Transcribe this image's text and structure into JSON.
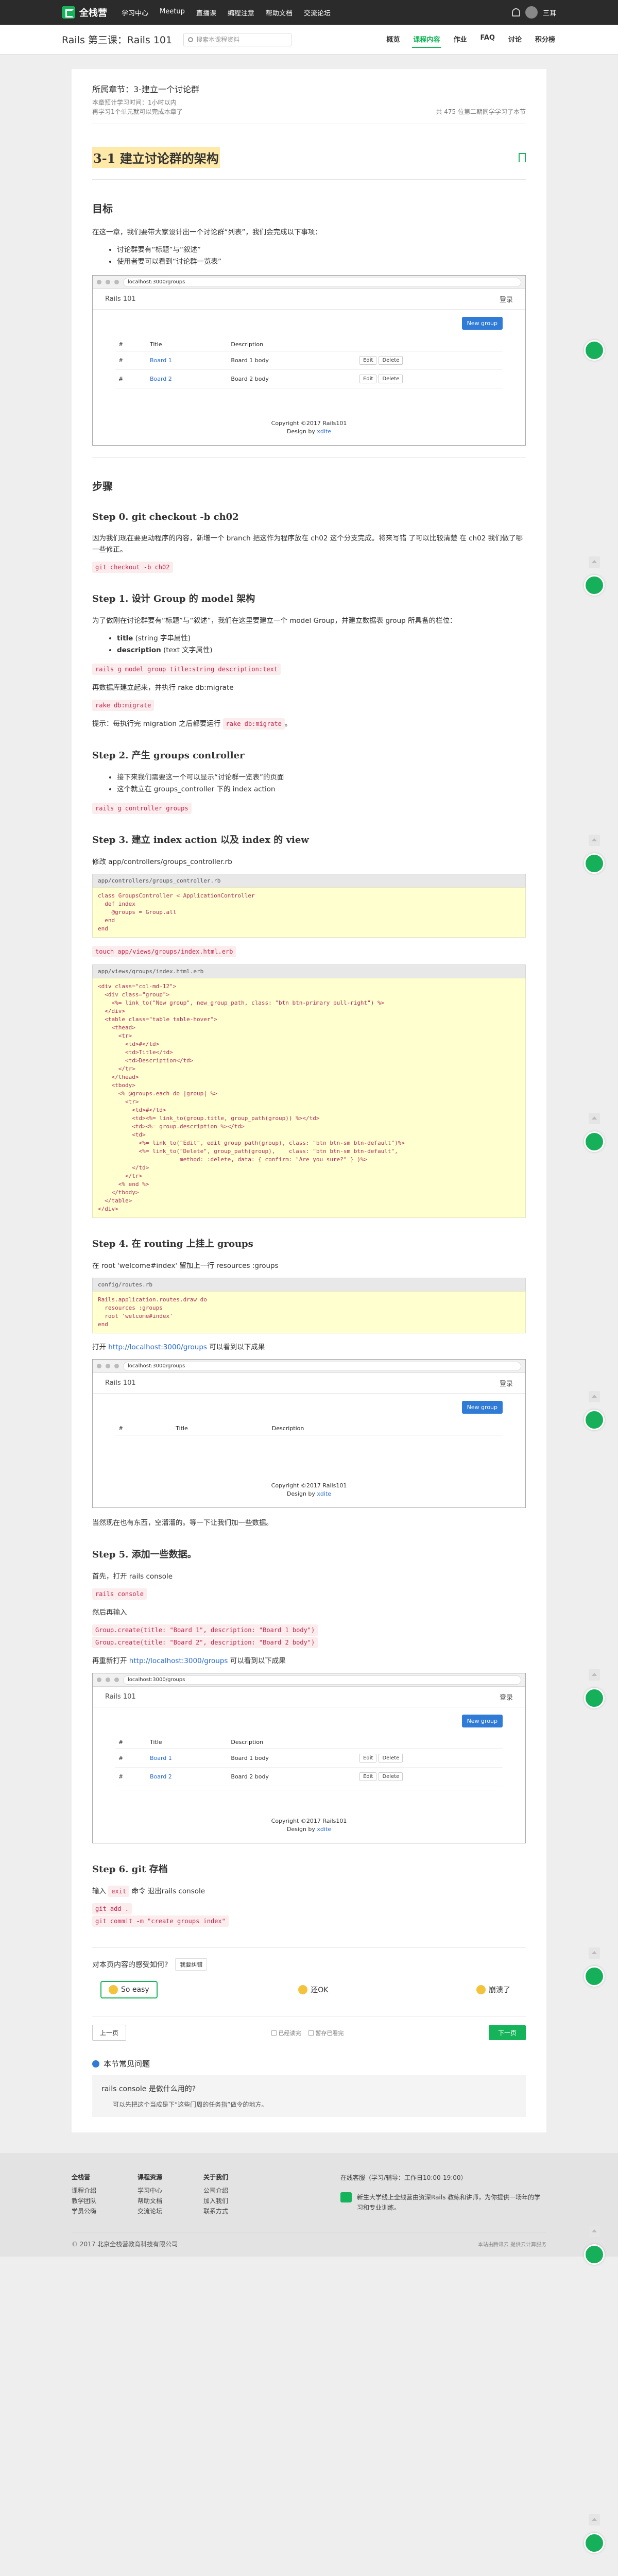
{
  "nav": {
    "brand": "全栈营",
    "links": [
      "学习中心",
      "Meetup",
      "直播课",
      "编程注意",
      "帮助文档",
      "交流论坛"
    ],
    "user": "三耳"
  },
  "sub": {
    "course": "Rails 第三课：Rails 101",
    "search_placeholder": "搜索本课程资料",
    "tabs": [
      "概览",
      "课程内容",
      "作业",
      "FAQ",
      "讨论",
      "积分榜"
    ]
  },
  "chapter": {
    "label": "所属章节：3-建立一个讨论群",
    "est": "本章预计学习时间：1小时以内",
    "progress": "再学习1个单元就可以完成本章了",
    "watch": "共 475 位第二期同学学习了本节"
  },
  "lesson": {
    "title": "3-1 建立讨论群的架构"
  },
  "goal": {
    "heading": "目标",
    "intro": "在这一章，我们要带大家设计出一个讨论群“列表”，我们会完成以下事项：",
    "items": [
      "讨论群要有“标题”与“叙述”",
      "使用者要可以看到“讨论群一览表”"
    ]
  },
  "browser": {
    "url": "localhost:3000/groups",
    "app": "Rails 101",
    "login": "登录",
    "new": "New group",
    "th": [
      "#",
      "Title",
      "Description",
      ""
    ],
    "rows": [
      [
        "#",
        "Board 1",
        "Board 1 body",
        "Edit",
        "Delete"
      ],
      [
        "#",
        "Board 2",
        "Board 2 body",
        "Edit",
        "Delete"
      ]
    ],
    "footer1": "Copyright ©2017 Rails101",
    "footer2a": "Design by ",
    "footer2b": "xdite"
  },
  "steps_heading": "步骤",
  "step0": {
    "title": "Step 0. git checkout -b ch02",
    "text": "因为我们现在要更动程序的内容，新增一个 branch 把这作为程序放在 ch02 这个分支完成。将来写错 了可以比较清楚 在 ch02 我们做了哪一些修正。",
    "cmd": "git checkout -b ch02"
  },
  "step1": {
    "title": "Step 1. 设计 Group 的 model 架构",
    "text": "为了做刚在讨论群要有“标题”与“叙述”，我们在这里要建立一个 model Group，并建立数据表 group 所具备的栏位：",
    "li1b": "title",
    "li1": " (string 字串属性)",
    "li2b": "description",
    "li2": " (text 文字属性)",
    "cmd": "rails g model group title:string description:text",
    "text2": "再数据库建立起来，并执行 rake db:migrate",
    "cmd2": "rake db:migrate",
    "tip": "提示：每执行完 migration 之后都要运行 ",
    "tipcmd": "rake db:migrate",
    "tipend": "。"
  },
  "step2": {
    "title": "Step 2. 产生 groups controller",
    "items": [
      "接下来我们需要这一个可以显示“讨论群一览表”的页面",
      "这个就立在 groups_controller 下的 index action"
    ],
    "cmd": "rails g controller groups"
  },
  "step3": {
    "title": "Step 3. 建立 index action 以及 index 的 view",
    "text": "修改 app/controllers/groups_controller.rb",
    "file1": "app/controllers/groups_controller.rb",
    "code1": "class GroupsController < ApplicationController\n  def index\n    @groups = Group.all\n  end\nend",
    "cmd": "touch app/views/groups/index.html.erb",
    "file2": "app/views/groups/index.html.erb",
    "code2": "<div class=\"col-md-12\">\n  <div class=\"group\">\n    <%= link_to(\"New group\", new_group_path, class: \"btn btn-primary pull-right\") %>\n  </div>\n  <table class=\"table table-hover\">\n    <thead>\n      <tr>\n        <td>#</td>\n        <td>Title</td>\n        <td>Description</td>\n      </tr>\n    </thead>\n    <tbody>\n      <% @groups.each do |group| %>\n        <tr>\n          <td>#</td>\n          <td><%= link_to(group.title, group_path(group)) %></td>\n          <td><%= group.description %></td>\n          <td>\n            <%= link_to(\"Edit\", edit_group_path(group), class: \"btn btn-sm btn-default\")%>\n            <%= link_to(\"Delete\", group_path(group),    class: \"btn btn-sm btn-default\",\n                        method: :delete, data: { confirm: \"Are you sure?\" } )%>\n          </td>\n        </tr>\n      <% end %>\n    </tbody>\n  </table>\n</div>"
  },
  "step4": {
    "title": "Step 4. 在 routing 上挂上 groups",
    "text": "在 root 'welcome#index' 留加上一行 resources :groups",
    "file": "config/routes.rb",
    "code": "Rails.application.routes.draw do\n  resources :groups\n  root 'welcome#index'\nend",
    "open_a": "打开 ",
    "open_link": "http://localhost:3000/groups",
    "open_b": " 可以看到以下成果",
    "after": "当然现在也有东西，空溜溜的。等一下让我们加一些数据。"
  },
  "step5": {
    "title": "Step 5. 添加一些数据。",
    "a": "首先，打开 rails console",
    "cmd1": "rails console",
    "b": "然后再输入",
    "cmd2": "Group.create(title: \"Board 1\", description: \"Board 1 body\")",
    "cmd3": "Group.create(title: \"Board 2\", description: \"Board 2 body\")",
    "c_a": "再重新打开 ",
    "c_link": "http://localhost:3000/groups",
    "c_b": " 可以看到以下成果"
  },
  "step6": {
    "title": "Step 6. git 存档",
    "a": "输入 ",
    "exit": "exit",
    "b": " 命令 退出rails console",
    "cmd1": "git add .",
    "cmd2": "git commit -m \"create groups index\""
  },
  "feedback": {
    "q": "对本页内容的感受如何?",
    "btn": "我要纠错",
    "opts": [
      "So easy",
      "还OK",
      "崩溃了"
    ]
  },
  "pager": {
    "prev": "上一页",
    "done": "已经读完",
    "later": "暂存已看完",
    "next": "下一页"
  },
  "qa": {
    "title": "本节常见问题",
    "q": "rails console 是做什么用的?",
    "a": "可以先把这个当成是下“这些门周的任务指”做令的地方。"
  },
  "footer": {
    "cols": [
      {
        "h": "全栈营",
        "items": [
          "课程介绍",
          "教学团队",
          "学员公嗨"
        ]
      },
      {
        "h": "课程资源",
        "items": [
          "学习中心",
          "帮助文档",
          "交流论坛"
        ]
      },
      {
        "h": "关于我们",
        "items": [
          "公司介绍",
          "加入我们",
          "联系方式"
        ]
      }
    ],
    "contact": "在线客服（学习/辅导：工作日10:00-19:00）",
    "about": "新生大学线上全线营由资深Rails 教练和讲师，为你提供一场年的学习和专业训练。",
    "copyright": "© 2017 北京全栈营教育科技有限公司",
    "badge": "本站由腾讯云 提供云计算服务"
  }
}
